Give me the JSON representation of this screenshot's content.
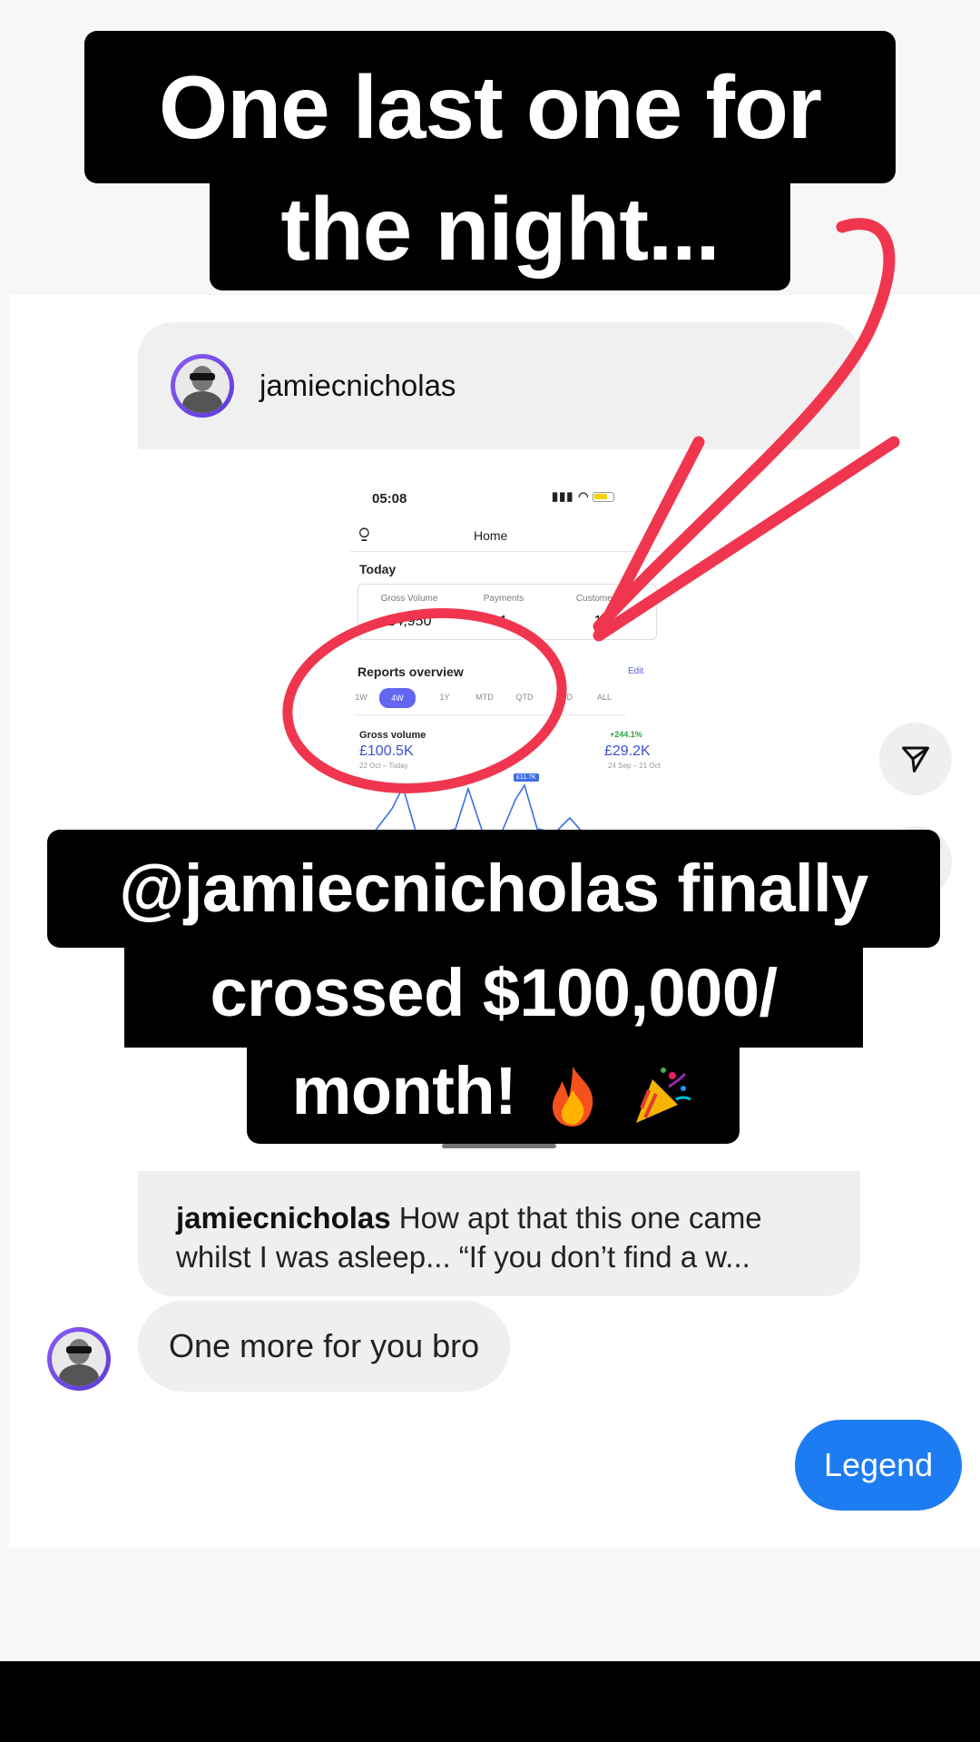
{
  "caption_top": [
    "One last one for",
    "the night..."
  ],
  "caption_bottom": [
    "@jamiecnicholas finally",
    "crossed $100,000/",
    "month!"
  ],
  "emojis": [
    "fire-emoji",
    "party-popper-emoji"
  ],
  "post": {
    "username": "jamiecnicholas",
    "phone": {
      "time": "05:08",
      "screen_title": "Home",
      "today_label": "Today",
      "stats": [
        {
          "label": "Gross Volume",
          "value": "£4,950"
        },
        {
          "label": "Payments",
          "value": "1"
        },
        {
          "label": "Customers",
          "value": "1"
        }
      ],
      "reports_label": "Reports overview",
      "edit_label": "Edit",
      "ranges": [
        "1W",
        "4W",
        "1Y",
        "MTD",
        "QTD",
        "YTD",
        "ALL"
      ],
      "active_range": "4W",
      "gross_volume_label": "Gross volume",
      "gross_volume_value": "£100.5K",
      "gross_volume_period": "22 Oct – Today",
      "change_pct": "+244.1%",
      "compare_value": "£29.2K",
      "compare_period": "24 Sep – 21 Oct",
      "tooltip": "£11.7K"
    }
  },
  "messages": {
    "reply_user": "jamiecnicholas",
    "reply_text": "How apt that this one came whilst I was asleep... “If you don’t find a w...",
    "incoming": "One more for you bro",
    "outgoing": "Legend"
  },
  "colors": {
    "annotation_red": "#f0364f",
    "outgoing_bubble": "#1d7cf2",
    "caption_bg": "#000000"
  }
}
